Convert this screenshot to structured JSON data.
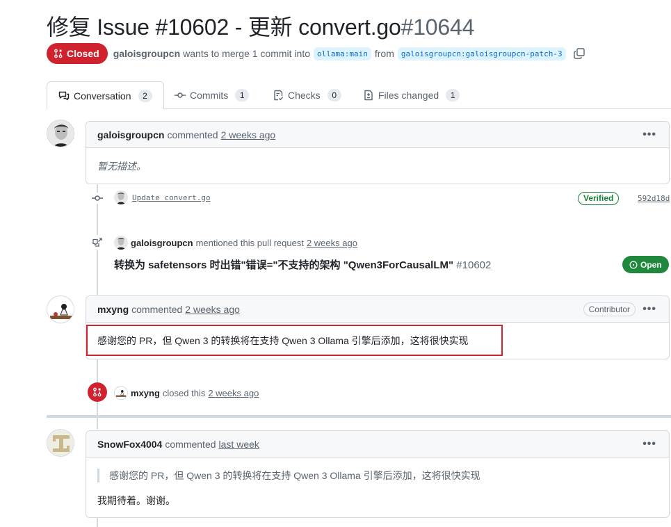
{
  "pr": {
    "title": "修复 Issue #10602 - 更新 convert.go",
    "number": "#10644",
    "state": "Closed",
    "author": "galoisgroupcn",
    "merge_text": "wants to merge 1 commit into",
    "base_branch": "ollama:main",
    "from_text": "from",
    "head_branch": "galoisgroupcn:galoisgroupcn-patch-3"
  },
  "tabs": [
    {
      "label": "Conversation",
      "count": "2"
    },
    {
      "label": "Commits",
      "count": "1"
    },
    {
      "label": "Checks",
      "count": "0"
    },
    {
      "label": "Files changed",
      "count": "1"
    }
  ],
  "comment1": {
    "author": "galoisgroupcn",
    "action": "commented",
    "time": "2 weeks ago",
    "body": "暂无描述。"
  },
  "commit": {
    "message": "Update convert.go",
    "verified": "Verified",
    "sha": "592d18d"
  },
  "mention": {
    "author": "galoisgroupcn",
    "action": "mentioned this pull request",
    "time": "2 weeks ago",
    "ref_title": "转换为 safetensors 时出错\"错误=\"不支持的架构 \"Qwen3ForCausalLM\"",
    "ref_number": "#10602",
    "ref_state": "Open"
  },
  "comment2": {
    "author": "mxyng",
    "action": "commented",
    "time": "2 weeks ago",
    "role": "Contributor",
    "body": "感谢您的 PR，但 Qwen 3 的转换将在支持 Qwen 3 Ollama 引擎后添加，这将很快实现"
  },
  "closed_event": {
    "author": "mxyng",
    "action": "closed this",
    "time": "2 weeks ago"
  },
  "comment3": {
    "author": "SnowFox4004",
    "action": "commented",
    "time": "last week",
    "quote": "感谢您的 PR，但 Qwen 3 的转换将在支持 Qwen 3 Ollama 引擎后添加，这将很快实现",
    "body": "我期待着。谢谢。"
  },
  "colors": {
    "closed": "#cf222e",
    "open": "#1f883d",
    "link": "#0969da",
    "highlight": "#d1242f"
  }
}
